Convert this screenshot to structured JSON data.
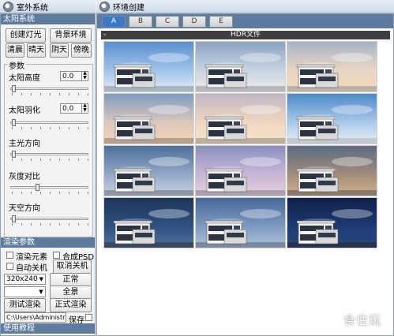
{
  "left_window": {
    "title": "室外系统"
  },
  "sun_section": {
    "header": "太阳系统",
    "buttons": {
      "create_light": "创建灯光",
      "background_env": "背景环境",
      "clear_morning": "清晨",
      "sunny": "晴天",
      "overcast": "阴天",
      "dusk": "傍晚"
    },
    "params_label": "参数",
    "sun_altitude": {
      "label": "太阳高度",
      "value": "0.0",
      "level": 0.02
    },
    "sun_feather": {
      "label": "太阳羽化",
      "value": "0.0",
      "level": 0.02
    },
    "main_light_dir": {
      "label": "主光方向",
      "level": 0.02
    },
    "gray_contrast": {
      "label": "灰度对比",
      "level": 0.35
    },
    "sky_dir": {
      "label": "天空方向",
      "level": 0.02
    }
  },
  "render_section": {
    "header": "渲染参数",
    "render_elements": "渲染元素",
    "composite_psd": "合成PSD",
    "auto_shutdown": "自动关机",
    "cancel_shutdown": "取消关机",
    "resolution": "320x240",
    "normal": "正常",
    "panorama": "全景",
    "preset": "",
    "test_render": "测试渲染",
    "final_render": "正式渲染",
    "path": "C:\\Users\\Administrator",
    "save": "保存"
  },
  "tutorial": "使用教程",
  "right_window": {
    "title": "环境创建",
    "tabs": [
      "A",
      "B",
      "C",
      "D",
      "E"
    ],
    "active_tab": "A",
    "hdr_label": "HDR文件",
    "collapse_sign": "-"
  },
  "thumbnails": [
    {
      "sky": [
        "#5b8fcf",
        "#9fc3ea",
        "#e9eff6"
      ],
      "ground": "#a7b3c0"
    },
    {
      "sky": [
        "#8aa4c3",
        "#c7d3e2",
        "#f2eee8"
      ],
      "ground": "#b6b8bc"
    },
    {
      "sky": [
        "#a6b4c7",
        "#e7d6c4",
        "#f4d9b8"
      ],
      "ground": "#bdb1a4"
    },
    {
      "sky": [
        "#7f9cc0",
        "#d9c7bd",
        "#f7d4b3"
      ],
      "ground": "#b79f8c"
    },
    {
      "sky": [
        "#c0b7c2",
        "#f0d6c0",
        "#f8e5cd"
      ],
      "ground": "#bfae9c"
    },
    {
      "sky": [
        "#4e89c9",
        "#a9c8e8",
        "#eef3f8"
      ],
      "ground": "#c2c8cf"
    },
    {
      "sky": [
        "#4f6f9b",
        "#91a7c6",
        "#cfd8e4"
      ],
      "ground": "#8e97a3"
    },
    {
      "sky": [
        "#8c8fbf",
        "#c6b6d6",
        "#e8d2d8"
      ],
      "ground": "#a89fb0"
    },
    {
      "sky": [
        "#5c6b82",
        "#a08c7c",
        "#d9b48c"
      ],
      "ground": "#8a7a6a"
    },
    {
      "sky": [
        "#1d3559",
        "#2f5080",
        "#53729d"
      ],
      "ground": "#3b4760"
    },
    {
      "sky": [
        "#46689a",
        "#7f9ac0",
        "#b3c4d9"
      ],
      "ground": "#7a8aa0"
    },
    {
      "sky": [
        "#10204a",
        "#1d3a73",
        "#2a4a85"
      ],
      "ground": "#27324e"
    }
  ],
  "watermark": "食住玩",
  "colors": {
    "section_header": "#5d7b9d",
    "active_tab": "#3b78c9"
  }
}
